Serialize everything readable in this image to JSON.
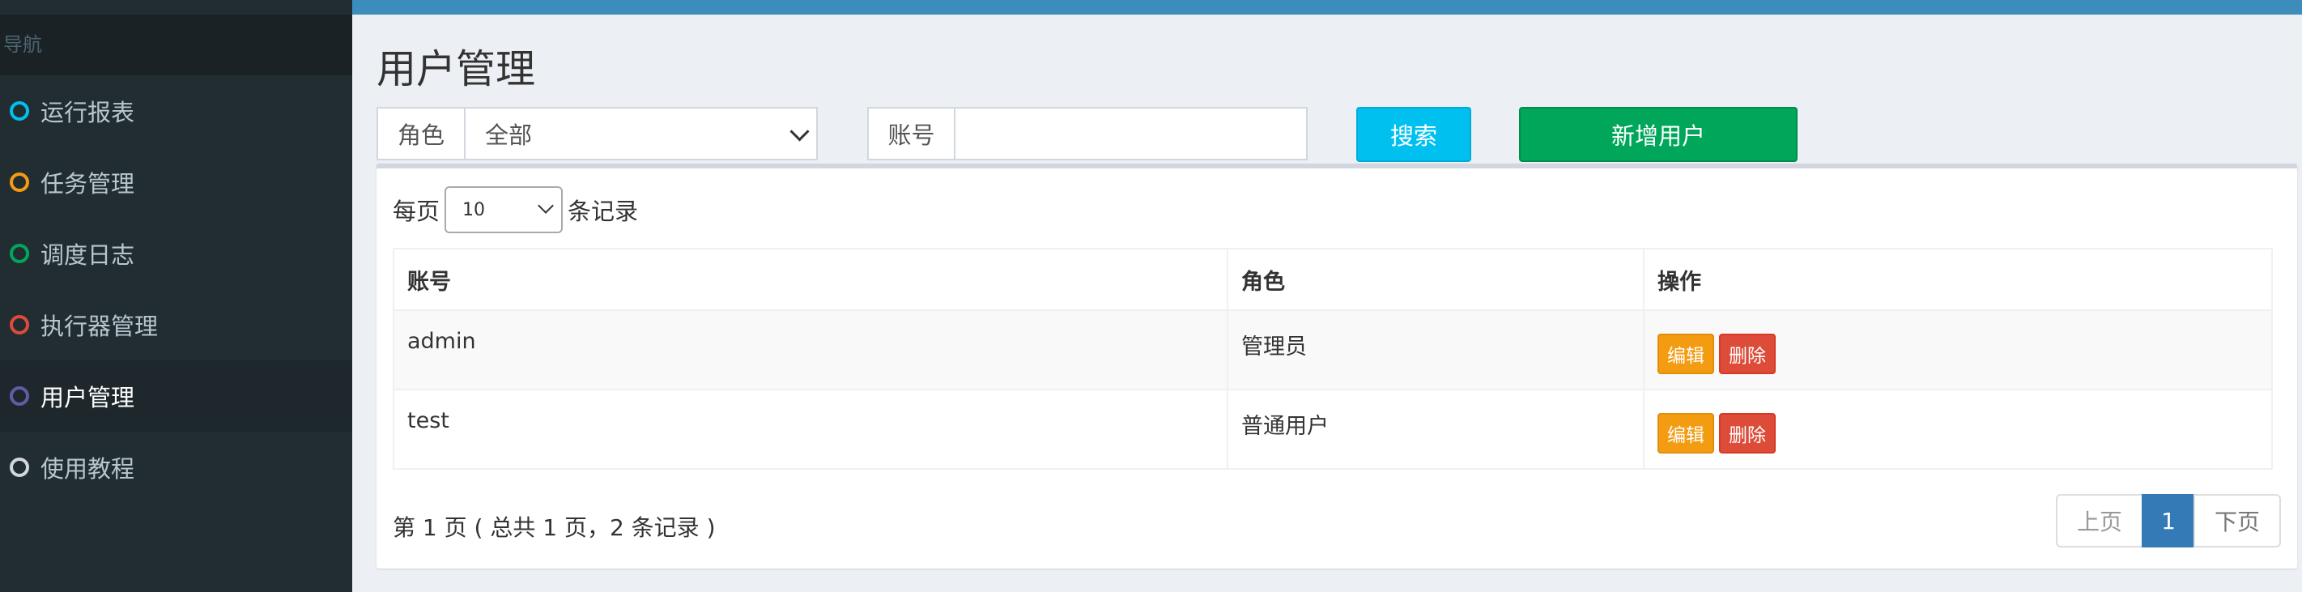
{
  "sidebar": {
    "header": "导航",
    "items": [
      {
        "label": "运行报表",
        "color": "#00c0ef",
        "active": false
      },
      {
        "label": "任务管理",
        "color": "#f39c12",
        "active": false
      },
      {
        "label": "调度日志",
        "color": "#00a65a",
        "active": false
      },
      {
        "label": "执行器管理",
        "color": "#dd4b39",
        "active": false
      },
      {
        "label": "用户管理",
        "color": "#605ca8",
        "active": true
      },
      {
        "label": "使用教程",
        "color": "#d2d6de",
        "active": false
      }
    ]
  },
  "main": {
    "title": "用户管理",
    "filters": {
      "role_label": "角色",
      "role_value": "全部",
      "account_label": "账号",
      "account_value": ""
    },
    "search_button": "搜索",
    "add_button": "新增用户",
    "page_length": {
      "prefix": "每页",
      "value": "10",
      "suffix": "条记录"
    },
    "table": {
      "columns": [
        "账号",
        "角色",
        "操作"
      ],
      "rows": [
        {
          "account": "admin",
          "role": "管理员",
          "edit": "编辑",
          "delete": "删除"
        },
        {
          "account": "test",
          "role": "普通用户",
          "edit": "编辑",
          "delete": "删除"
        }
      ]
    },
    "info": "第 1 页 ( 总共 1 页，2 条记录 )",
    "pagination": {
      "prev": "上页",
      "current": "1",
      "next": "下页"
    }
  }
}
